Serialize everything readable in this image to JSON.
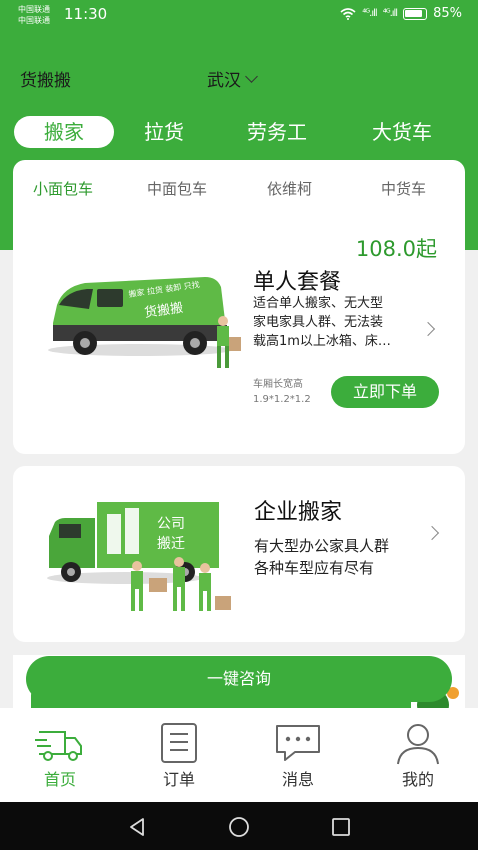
{
  "status_bar": {
    "carrier1": "中国联通",
    "carrier2": "中国联通",
    "time": "11:30",
    "signal1": "⁴ᴳ.ıll",
    "signal2": "⁴ᴳ.ıll",
    "battery": "85%"
  },
  "header": {
    "app_title": "货搬搬",
    "city": "武汉"
  },
  "top_tabs": [
    {
      "label": "搬家",
      "active": true
    },
    {
      "label": "拉货",
      "active": false
    },
    {
      "label": "劳务工",
      "active": false
    },
    {
      "label": "大货车",
      "active": false
    }
  ],
  "vehicle_tabs": [
    {
      "label": "小面包车",
      "active": true
    },
    {
      "label": "中面包车",
      "active": false
    },
    {
      "label": "依维柯",
      "active": false
    },
    {
      "label": "中货车",
      "active": false
    }
  ],
  "package": {
    "price": "108.0起",
    "title": "单人套餐",
    "desc_line1": "适合单人搬家、无大型",
    "desc_line2": "家电家具人群、无法装",
    "desc_line3": "载高1m以上冰箱、床…",
    "dim_label": "车厢长宽高",
    "dim_value": "1.9*1.2*1.2",
    "order_button": "立即下单",
    "van_text1": "搬家 拉货 装卸 只找",
    "van_text2": "货搬搬"
  },
  "enterprise": {
    "title": "企业搬家",
    "desc_line1": "有大型办公家具人群",
    "desc_line2": "各种车型应有尽有",
    "truck_text1": "公司",
    "truck_text2": "搬迁"
  },
  "consult_button": "一键咨询",
  "bottom_nav": [
    {
      "label": "首页",
      "icon": "truck-icon",
      "active": true
    },
    {
      "label": "订单",
      "icon": "order-list-icon",
      "active": false
    },
    {
      "label": "消息",
      "icon": "message-icon",
      "active": false
    },
    {
      "label": "我的",
      "icon": "profile-icon",
      "active": false
    }
  ],
  "colors": {
    "brand_green": "#3cad3c",
    "active_text_green": "#2e9a2e",
    "background": "#f0f0f0"
  }
}
